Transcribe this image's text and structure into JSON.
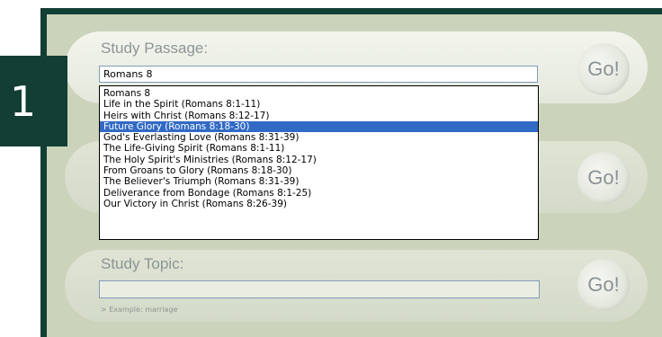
{
  "badge": {
    "number": "1"
  },
  "passage": {
    "label": "Study Passage:",
    "input_value": "Romans 8",
    "go_label": "Go!"
  },
  "middle": {
    "go_label": "Go!"
  },
  "topic": {
    "label": "Study Topic:",
    "input_value": "",
    "example": "> Example: marriage",
    "go_label": "Go!"
  },
  "dropdown": {
    "selected_index": 3,
    "items": [
      "Romans 8",
      "Life in the Spirit (Romans 8:1-11)",
      "Heirs with Christ (Romans 8:12-17)",
      "Future Glory (Romans 8:18-30)",
      "God's Everlasting Love (Romans 8:31-39)",
      "The Life-Giving Spirit (Romans 8:1-11)",
      "The Holy Spirit's Ministries (Romans 8:12-17)",
      "From Groans to Glory (Romans 8:18-30)",
      "The Believer's Triumph (Romans 8:31-39)",
      "Deliverance from Bondage (Romans 8:1-25)",
      "Our Victory in Christ (Romans 8:26-39)"
    ]
  },
  "colors": {
    "frame": "#123e34",
    "panel": "#cbd3bb",
    "selection": "#316ac5"
  }
}
